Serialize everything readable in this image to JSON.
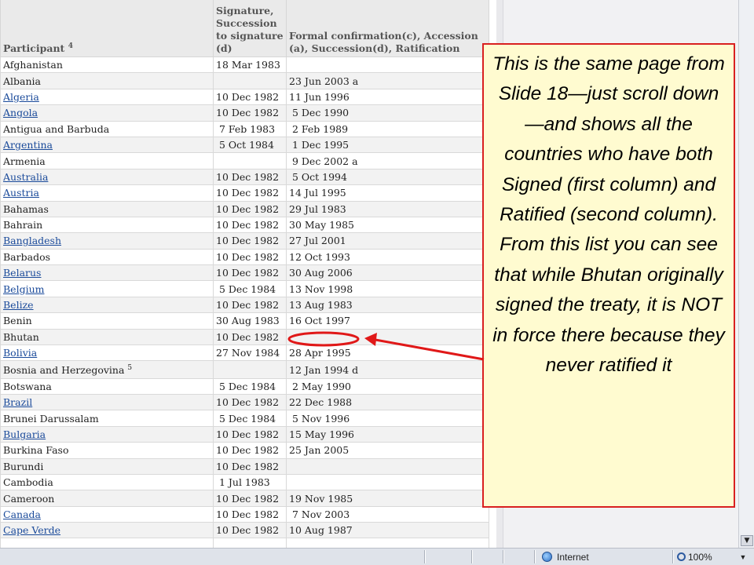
{
  "table": {
    "headers": {
      "participant": "Participant",
      "participant_note": "4",
      "signature": "Signature, Succession to signature (d)",
      "confirmation": "Formal confirmation(c), Accession (a), Succession(d), Ratification"
    },
    "rows": [
      {
        "name": "Afghanistan",
        "link": false,
        "note": "",
        "sig": "18 Mar 1983",
        "rat": ""
      },
      {
        "name": "Albania",
        "link": false,
        "note": "",
        "sig": "",
        "rat": "23 Jun 2003 a"
      },
      {
        "name": "Algeria",
        "link": true,
        "note": "",
        "sig": "10 Dec 1982",
        "rat": "11 Jun 1996"
      },
      {
        "name": "Angola",
        "link": true,
        "note": "",
        "sig": "10 Dec 1982",
        "rat": " 5 Dec 1990"
      },
      {
        "name": "Antigua and Barbuda",
        "link": false,
        "note": "",
        "sig": " 7 Feb 1983",
        "rat": " 2 Feb 1989"
      },
      {
        "name": "Argentina",
        "link": true,
        "note": "",
        "sig": " 5 Oct 1984",
        "rat": " 1 Dec 1995"
      },
      {
        "name": "Armenia",
        "link": false,
        "note": "",
        "sig": "",
        "rat": " 9 Dec 2002 a"
      },
      {
        "name": "Australia",
        "link": true,
        "note": "",
        "sig": "10 Dec 1982",
        "rat": " 5 Oct 1994"
      },
      {
        "name": "Austria",
        "link": true,
        "note": "",
        "sig": "10 Dec 1982",
        "rat": "14 Jul 1995"
      },
      {
        "name": "Bahamas",
        "link": false,
        "note": "",
        "sig": "10 Dec 1982",
        "rat": "29 Jul 1983"
      },
      {
        "name": "Bahrain",
        "link": false,
        "note": "",
        "sig": "10 Dec 1982",
        "rat": "30 May 1985"
      },
      {
        "name": "Bangladesh",
        "link": true,
        "note": "",
        "sig": "10 Dec 1982",
        "rat": "27 Jul 2001"
      },
      {
        "name": "Barbados",
        "link": false,
        "note": "",
        "sig": "10 Dec 1982",
        "rat": "12 Oct 1993"
      },
      {
        "name": "Belarus",
        "link": true,
        "note": "",
        "sig": "10 Dec 1982",
        "rat": "30 Aug 2006"
      },
      {
        "name": "Belgium",
        "link": true,
        "note": "",
        "sig": " 5 Dec 1984",
        "rat": "13 Nov 1998"
      },
      {
        "name": "Belize",
        "link": true,
        "note": "",
        "sig": "10 Dec 1982",
        "rat": "13 Aug 1983"
      },
      {
        "name": "Benin",
        "link": false,
        "note": "",
        "sig": "30 Aug 1983",
        "rat": "16 Oct 1997"
      },
      {
        "name": "Bhutan",
        "link": false,
        "note": "",
        "sig": "10 Dec 1982",
        "rat": ""
      },
      {
        "name": "Bolivia",
        "link": true,
        "note": "",
        "sig": "27 Nov 1984",
        "rat": "28 Apr 1995"
      },
      {
        "name": "Bosnia and Herzegovina",
        "link": false,
        "note": "5",
        "sig": "",
        "rat": "12 Jan 1994 d"
      },
      {
        "name": "Botswana",
        "link": false,
        "note": "",
        "sig": " 5 Dec 1984",
        "rat": " 2 May 1990"
      },
      {
        "name": "Brazil",
        "link": true,
        "note": "",
        "sig": "10 Dec 1982",
        "rat": "22 Dec 1988"
      },
      {
        "name": "Brunei Darussalam",
        "link": false,
        "note": "",
        "sig": " 5 Dec 1984",
        "rat": " 5 Nov 1996"
      },
      {
        "name": "Bulgaria",
        "link": true,
        "note": "",
        "sig": "10 Dec 1982",
        "rat": "15 May 1996"
      },
      {
        "name": "Burkina Faso",
        "link": false,
        "note": "",
        "sig": "10 Dec 1982",
        "rat": "25 Jan 2005"
      },
      {
        "name": "Burundi",
        "link": false,
        "note": "",
        "sig": "10 Dec 1982",
        "rat": ""
      },
      {
        "name": "Cambodia",
        "link": false,
        "note": "",
        "sig": " 1 Jul 1983",
        "rat": ""
      },
      {
        "name": "Cameroon",
        "link": false,
        "note": "",
        "sig": "10 Dec 1982",
        "rat": "19 Nov 1985"
      },
      {
        "name": "Canada",
        "link": true,
        "note": "",
        "sig": "10 Dec 1982",
        "rat": " 7 Nov 2003"
      },
      {
        "name": "Cape Verde",
        "link": true,
        "note": "",
        "sig": "10 Dec 1982",
        "rat": "10 Aug 1987"
      },
      {
        "name": "",
        "link": false,
        "note": "",
        "sig": "",
        "rat": ""
      }
    ]
  },
  "callout": {
    "text": "This is the same page from Slide 18—just scroll down—and shows all the countries who have both Signed (first column) and Ratified (second column).   From this list you can see that while Bhutan originally signed the treaty, it is NOT in force there because they never ratified it",
    "border_color": "#d92020",
    "background": "#fffbd0"
  },
  "annotation": {
    "color": "#e01818",
    "highlighted_row": "Bhutan"
  },
  "status_bar": {
    "zone": "Internet",
    "zoom": "100%",
    "zone_icon": "globe-icon",
    "zoom_icon": "magnifier-icon"
  }
}
